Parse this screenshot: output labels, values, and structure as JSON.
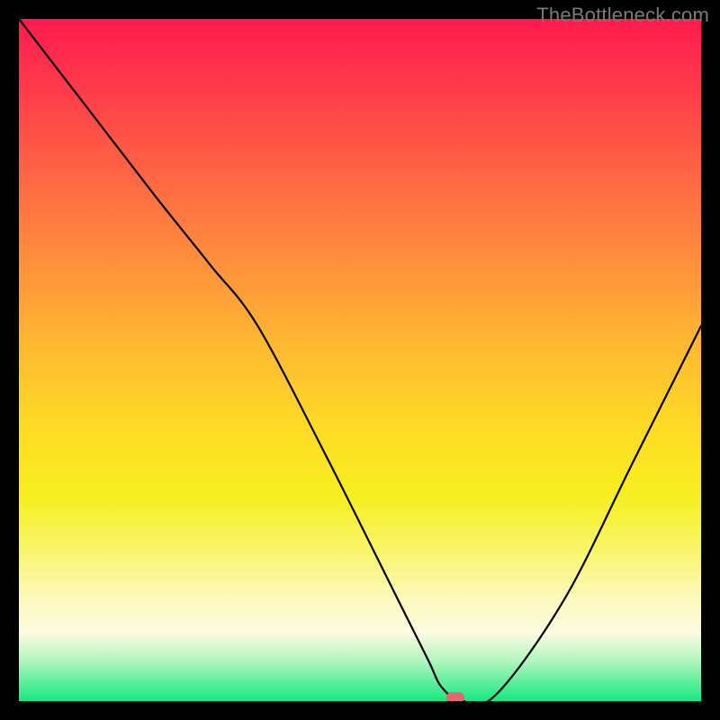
{
  "watermark": {
    "text": "TheBottleneck.com"
  },
  "chart_data": {
    "type": "line",
    "title": "",
    "xlabel": "",
    "ylabel": "",
    "xlim": [
      0,
      100
    ],
    "ylim": [
      0,
      100
    ],
    "grid": false,
    "legend": false,
    "series": [
      {
        "name": "curve",
        "x": [
          0,
          10,
          20,
          28,
          35,
          45,
          55,
          60,
          62,
          65,
          70,
          80,
          90,
          100
        ],
        "y": [
          100,
          87,
          74,
          64,
          55,
          36,
          16,
          6,
          2,
          0,
          1,
          15,
          35,
          55
        ]
      }
    ],
    "annotations": [
      {
        "name": "marker",
        "x": 64,
        "y": 0.5,
        "color": "#e06a6f"
      }
    ],
    "background_gradient_top_to_bottom": [
      "#ff1a4d",
      "#ff7d3f",
      "#ffdb24",
      "#f9f56b",
      "#fcfbe2",
      "#15e880"
    ]
  }
}
